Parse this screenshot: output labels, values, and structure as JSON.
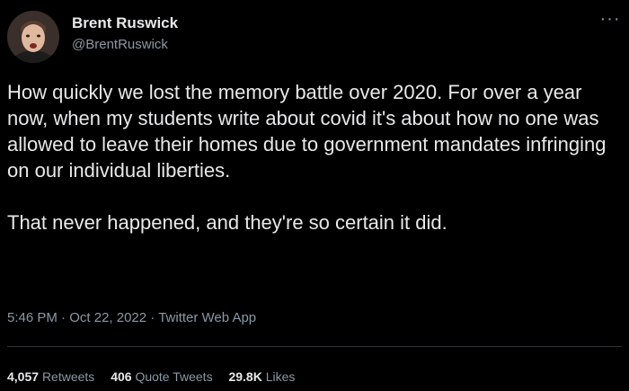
{
  "tweet": {
    "author": {
      "name": "Brent Ruswick",
      "handle": "@BrentRuswick"
    },
    "more_icon": "more-horizontal-icon",
    "text": "How quickly we lost the memory battle over 2020. For over a year now, when my students write about covid it's about how no one was allowed to leave their homes due to government mandates infringing on our individual liberties.\n\nThat never happened, and they're so certain it did.",
    "meta": {
      "time": "5:46 PM",
      "separator": " · ",
      "date": "Oct 22, 2022",
      "source": "Twitter Web App"
    },
    "stats": [
      {
        "count": "4,057",
        "label": "Retweets"
      },
      {
        "count": "406",
        "label": "Quote Tweets"
      },
      {
        "count": "29.8K",
        "label": "Likes"
      }
    ]
  },
  "colors": {
    "background": "#000000",
    "primary_text": "#e7e9ea",
    "secondary_text": "#8b98a5",
    "divider": "#2f3336"
  }
}
